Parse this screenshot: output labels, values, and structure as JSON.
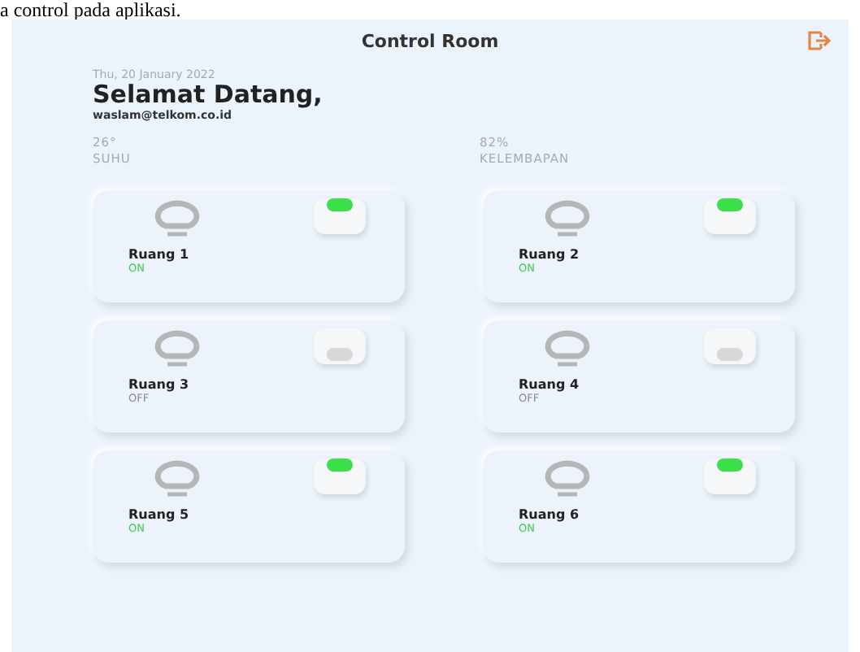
{
  "caption": "a control pada aplikasi.",
  "app": {
    "title": "Control Room",
    "date": "Thu, 20 January 2022",
    "greeting": "Selamat Datang,",
    "email": "waslam@telkom.co.id",
    "stats": [
      {
        "value": "26°",
        "label": "SUHU"
      },
      {
        "value": "82%",
        "label": "KELEMBAPAN"
      }
    ],
    "rooms": [
      {
        "name": "Ruang 1",
        "status": "ON",
        "on": true
      },
      {
        "name": "Ruang 2",
        "status": "ON",
        "on": true
      },
      {
        "name": "Ruang 3",
        "status": "OFF",
        "on": false
      },
      {
        "name": "Ruang 4",
        "status": "OFF",
        "on": false
      },
      {
        "name": "Ruang 5",
        "status": "ON",
        "on": true
      },
      {
        "name": "Ruang 6",
        "status": "ON",
        "on": true
      }
    ]
  }
}
